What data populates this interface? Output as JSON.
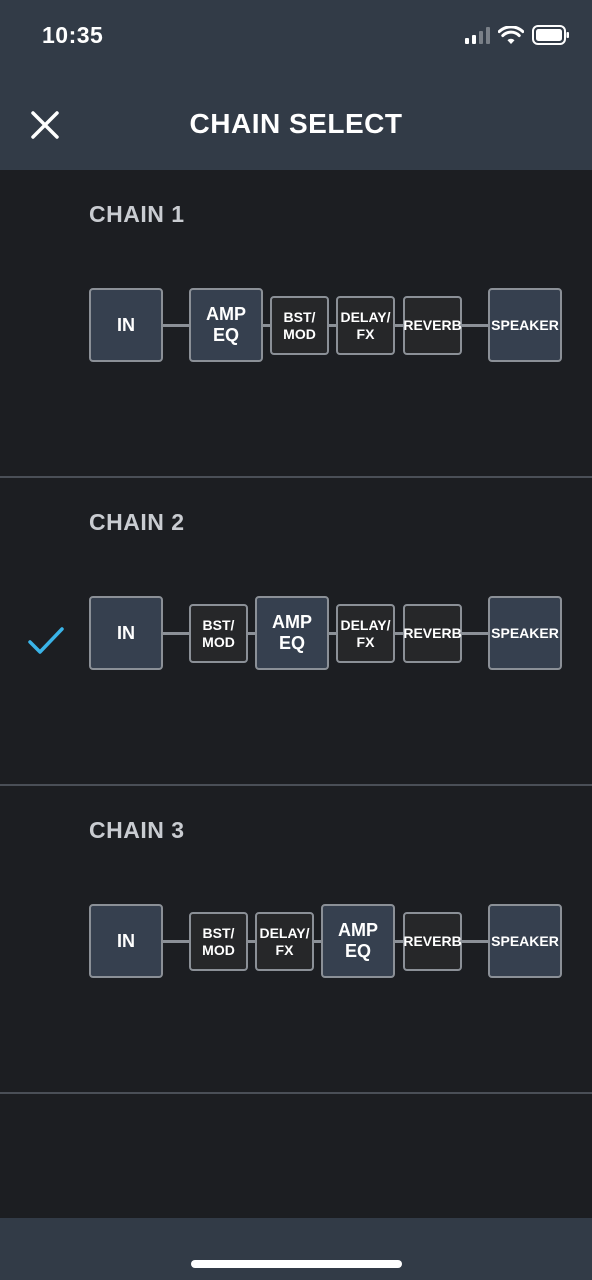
{
  "status_bar": {
    "time": "10:35"
  },
  "nav": {
    "title": "CHAIN SELECT",
    "close_icon": "close-icon"
  },
  "chains": [
    {
      "title": "CHAIN 1",
      "selected": false,
      "blocks": [
        "IN",
        "AMP\nEQ",
        "BST/\nMOD",
        "DELAY/\nFX",
        "REVERB",
        "SPEAKER"
      ]
    },
    {
      "title": "CHAIN 2",
      "selected": true,
      "blocks": [
        "IN",
        "BST/\nMOD",
        "AMP\nEQ",
        "DELAY/\nFX",
        "REVERB",
        "SPEAKER"
      ]
    },
    {
      "title": "CHAIN 3",
      "selected": false,
      "blocks": [
        "IN",
        "BST/\nMOD",
        "DELAY/\nFX",
        "AMP\nEQ",
        "REVERB",
        "SPEAKER"
      ]
    }
  ],
  "colors": {
    "background": "#1c1e22",
    "bar": "#323b47",
    "accent_check": "#3ab4e8",
    "big_block": "#36404f",
    "small_block": "#262729"
  }
}
